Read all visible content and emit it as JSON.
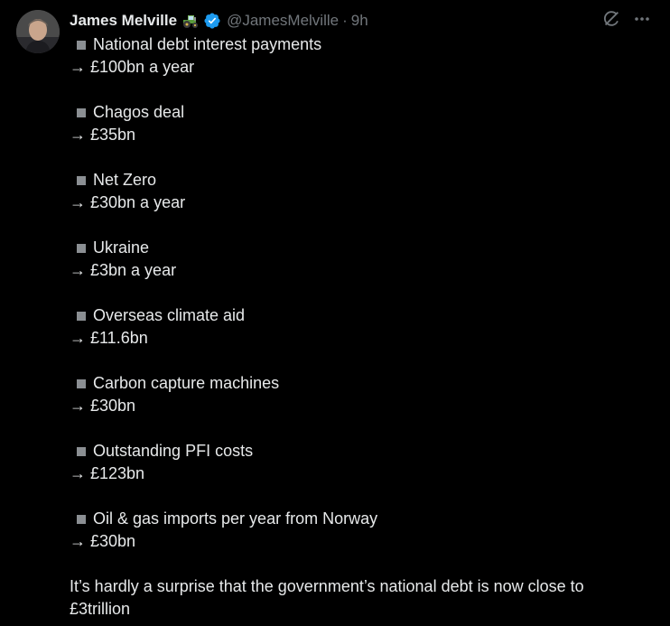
{
  "author": {
    "display_name": "James Melville",
    "emoji_icon": "tractor-icon",
    "handle": "@JamesMelville",
    "separator": "·",
    "time": "9h",
    "verified_color": "#1d9bf0"
  },
  "actions": {
    "grok_icon": "grok-icon",
    "more_icon": "more-icon"
  },
  "items": [
    {
      "title": "National debt interest payments",
      "value": "→ £100bn a year"
    },
    {
      "title": "Chagos deal",
      "value": "→ £35bn"
    },
    {
      "title": "Net Zero",
      "value": "→ £30bn a year"
    },
    {
      "title": "Ukraine",
      "value": "→ £3bn a year"
    },
    {
      "title": "Overseas climate aid",
      "value": "→ £11.6bn"
    },
    {
      "title": "Carbon capture machines",
      "value": "→ £30bn"
    },
    {
      "title": "Outstanding PFI costs",
      "value": "→ £123bn"
    },
    {
      "title": "Oil & gas imports per year from Norway",
      "value": "→ £30bn"
    }
  ],
  "conclusion": "It’s hardly a surprise that the government’s national debt is now close to £3trillion",
  "colors": {
    "background": "#000000",
    "text": "#e7e9ea",
    "muted": "#71767b"
  }
}
